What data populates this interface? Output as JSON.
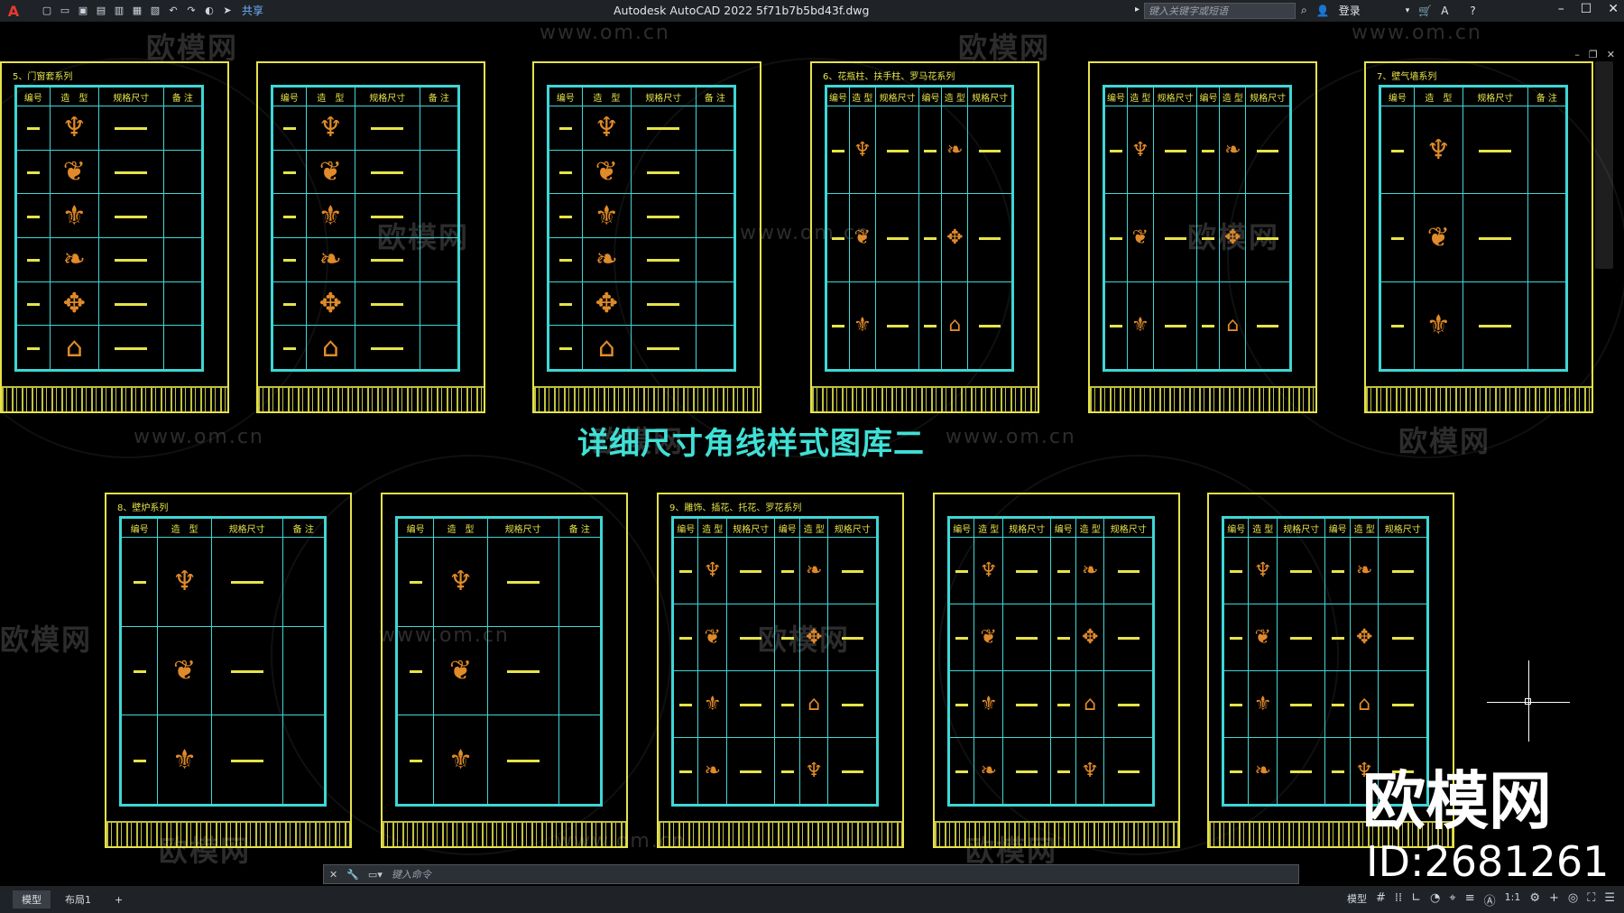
{
  "titlebar": {
    "app_logo": "A",
    "quick_access_icons": [
      "new-icon",
      "open-icon",
      "save-icon",
      "save-as-icon",
      "publish-icon",
      "plot-preview-icon",
      "print-icon",
      "undo-icon",
      "redo-icon",
      "workspace-icon"
    ],
    "share_label": "共享",
    "title": "Autodesk AutoCAD 2022    5f71b7b5bd43f.dwg",
    "search_placeholder": "键入关键字或短语",
    "login_label": "登录"
  },
  "watermark": {
    "text": "欧模网",
    "url": "www.om.cn",
    "big_text": "欧模网",
    "id_text": "ID:2681261"
  },
  "drawing": {
    "main_title": "详细尺寸角线样式图库二",
    "top_sheets": [
      {
        "label": "5、门窗套系列",
        "headers": [
          "编号",
          "造　型",
          "规格尺寸",
          "备 注"
        ],
        "rows": 6
      },
      {
        "label": "",
        "headers": [
          "编号",
          "造　型",
          "规格尺寸",
          "备 注"
        ],
        "rows": 6
      },
      {
        "label": "",
        "headers": [
          "编号",
          "造　型",
          "规格尺寸",
          "备 注"
        ],
        "rows": 6
      },
      {
        "label": "6、花瓶柱、扶手柱、罗马花系列",
        "headers": [
          "编号",
          "造 型",
          "规格尺寸",
          "编号",
          "造 型",
          "规格尺寸"
        ],
        "rows": 3
      },
      {
        "label": "",
        "headers": [
          "编号",
          "造 型",
          "规格尺寸",
          "编号",
          "造 型",
          "规格尺寸"
        ],
        "rows": 3
      },
      {
        "label": "7、壁气墙系列",
        "headers": [
          "编号",
          "造　型",
          "规格尺寸",
          "备 注"
        ],
        "rows": 3
      }
    ],
    "bottom_sheets": [
      {
        "label": "8、壁炉系列",
        "headers": [
          "编号",
          "造　型",
          "规格尺寸",
          "备 注"
        ],
        "rows": 3
      },
      {
        "label": "",
        "headers": [
          "编号",
          "造　型",
          "规格尺寸",
          "备 注"
        ],
        "rows": 3
      },
      {
        "label": "9、雕饰、插花、托花、罗花系列",
        "headers": [
          "编号",
          "造 型",
          "规格尺寸",
          "编号",
          "造 型",
          "规格尺寸"
        ],
        "rows": 4
      },
      {
        "label": "",
        "headers": [
          "编号",
          "造 型",
          "规格尺寸",
          "编号",
          "造 型",
          "规格尺寸"
        ],
        "rows": 4
      },
      {
        "label": "",
        "headers": [
          "编号",
          "造 型",
          "规格尺寸",
          "编号",
          "造 型",
          "规格尺寸"
        ],
        "rows": 4
      }
    ]
  },
  "command_line": {
    "placeholder": "键入命令"
  },
  "statusbar": {
    "tabs": [
      "模型",
      "布局1",
      "+"
    ],
    "model_label": "模型",
    "scale_label": "1:1"
  }
}
